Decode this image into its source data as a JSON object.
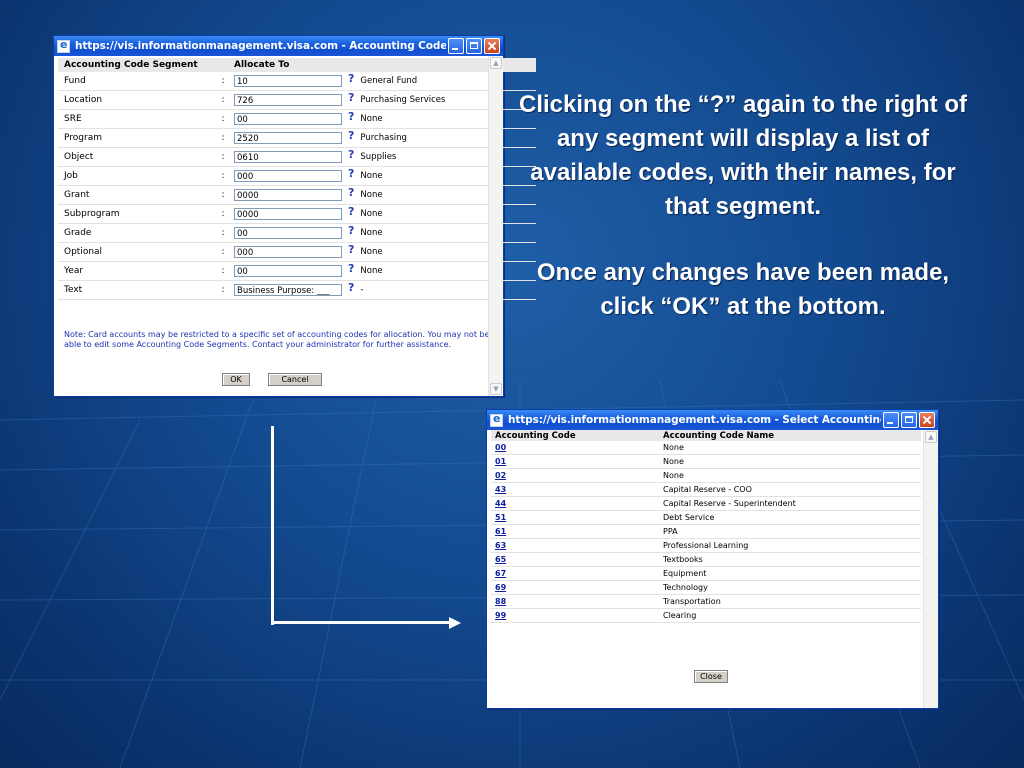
{
  "window_alloc": {
    "title": "https://vis.informationmanagement.visa.com - Accounting Code Segme...",
    "headers": {
      "segment": "Accounting Code Segment",
      "allocate": "Allocate To"
    },
    "colon": ":",
    "question": "?",
    "rows": [
      {
        "segment": "Fund",
        "value": "10",
        "name": "General Fund"
      },
      {
        "segment": "Location",
        "value": "726",
        "name": "Purchasing Services"
      },
      {
        "segment": "SRE",
        "value": "00",
        "name": "None"
      },
      {
        "segment": "Program",
        "value": "2520",
        "name": "Purchasing"
      },
      {
        "segment": "Object",
        "value": "0610",
        "name": "Supplies"
      },
      {
        "segment": "Job",
        "value": "000",
        "name": "None"
      },
      {
        "segment": "Grant",
        "value": "0000",
        "name": "None"
      },
      {
        "segment": "Subprogram",
        "value": "0000",
        "name": "None"
      },
      {
        "segment": "Grade",
        "value": "00",
        "name": "None"
      },
      {
        "segment": "Optional",
        "value": "000",
        "name": "None"
      },
      {
        "segment": "Year",
        "value": "00",
        "name": "None"
      },
      {
        "segment": "Text",
        "value": "Business Purpose: ___",
        "name": "-"
      }
    ],
    "note": "Note: Card accounts may be restricted to a specific set of accounting codes for allocation. You may not be able to edit some Accounting Code Segments. Contact your administrator for further assistance.",
    "ok_label": "OK",
    "cancel_label": "Cancel"
  },
  "window_codes": {
    "title": "https://vis.informationmanagement.visa.com - Select Accounting Codes - Micros...",
    "headers": {
      "code": "Accounting Code",
      "name": "Accounting Code Name"
    },
    "rows": [
      {
        "code": "00",
        "name": "None"
      },
      {
        "code": "01",
        "name": "None"
      },
      {
        "code": "02",
        "name": "None"
      },
      {
        "code": "43",
        "name": "Capital Reserve - COO"
      },
      {
        "code": "44",
        "name": "Capital Reserve - Superintendent"
      },
      {
        "code": "51",
        "name": "Debt Service"
      },
      {
        "code": "61",
        "name": "PPA"
      },
      {
        "code": "63",
        "name": "Professional Learning"
      },
      {
        "code": "65",
        "name": "Textbooks"
      },
      {
        "code": "67",
        "name": "Equipment"
      },
      {
        "code": "69",
        "name": "Technology"
      },
      {
        "code": "88",
        "name": "Transportation"
      },
      {
        "code": "99",
        "name": "Clearing"
      }
    ],
    "close_label": "Close"
  },
  "caption": {
    "paragraph1": "Clicking on the “?” again to the right of any segment will display a list of available codes, with their names, for that segment.",
    "paragraph2": "Once any changes have been made, click “OK” at the bottom."
  },
  "colors": {
    "background": "#134a8f",
    "titlebar": "#1d63e0",
    "link": "#1020a0",
    "note_text": "#1b33b0",
    "question_mark": "#2440b8"
  }
}
